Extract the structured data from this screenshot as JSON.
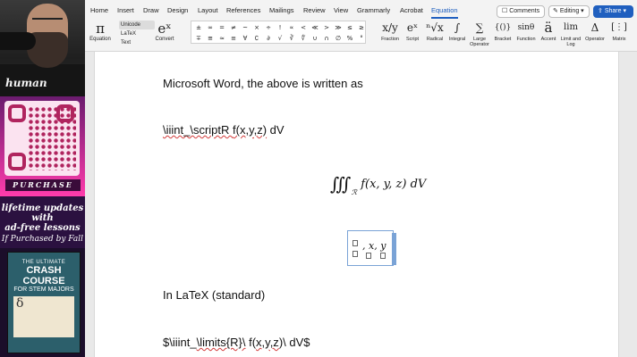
{
  "webcam": {
    "overlay_text": "human"
  },
  "promo": {
    "purchase_label": "PURCHASE",
    "lifetime_lines": [
      "lifetime updates with",
      "ad-free lessons",
      "If Purchased by Fall"
    ],
    "book": {
      "top": "THE ULTIMATE",
      "title_1": "CRASH COURSE",
      "title_2": "FOR STEM MAJORS",
      "glyph": "δ"
    }
  },
  "ribbon": {
    "tabs": [
      "Home",
      "Insert",
      "Draw",
      "Design",
      "Layout",
      "References",
      "Mailings",
      "Review",
      "View",
      "Grammarly",
      "Acrobat",
      "Equation"
    ],
    "active_tab": "Equation",
    "comments_label": "Comments",
    "editing_label": "Editing",
    "share_label": "Share",
    "equation": {
      "glyph": "π",
      "label": "Equation"
    },
    "conversions": [
      "Unicode",
      "LaTeX",
      "Text"
    ],
    "selected_conversion": "Unicode",
    "convert": {
      "glyph": "eˣ",
      "label": "Convert"
    },
    "symbols": [
      "±",
      "∞",
      "=",
      "≠",
      "~",
      "×",
      "÷",
      "!",
      "∝",
      "<",
      "≪",
      ">",
      "≫",
      "≤",
      "≥",
      "∓",
      "≅",
      "≈",
      "≡",
      "∀",
      "∁",
      "∂",
      "√",
      "∛",
      "∜",
      "∪",
      "∩",
      "∅",
      "%",
      "°"
    ],
    "structures": [
      {
        "glyph": "x/y",
        "label": "Fraction"
      },
      {
        "glyph": "eˣ",
        "label": "Script"
      },
      {
        "glyph": "ⁿ√x",
        "label": "Radical"
      },
      {
        "glyph": "∫",
        "label": "Integral"
      },
      {
        "glyph": "∑",
        "label": "Large Operator"
      },
      {
        "glyph": "{()}",
        "label": "Bracket"
      },
      {
        "glyph": "sinθ",
        "label": "Function"
      },
      {
        "glyph": "ä",
        "label": "Accent"
      },
      {
        "glyph": "lim",
        "label": "Limit and Log"
      },
      {
        "glyph": "Δ",
        "label": "Operator"
      },
      {
        "glyph": "[⋮]",
        "label": "Matrix"
      }
    ]
  },
  "document": {
    "line_1": "Microsoft Word, the above is written as",
    "line_2_a": "\\iiint_\\scriptR ",
    "line_2_b": "f(x,y,z)",
    "line_2_c": " dV",
    "display_eq": {
      "integral": "∭",
      "subscript": "ℛ",
      "body": "f(x, y, z) dV"
    },
    "eq_box_text": ", x, y",
    "line_3": "In LaTeX (standard)",
    "line_4_a": "$\\iiint_",
    "line_4_b": "\\limits{R}\\",
    "line_4_c": " f(",
    "line_4_d": "x,y,z",
    "line_4_e": ")\\ dV$"
  }
}
